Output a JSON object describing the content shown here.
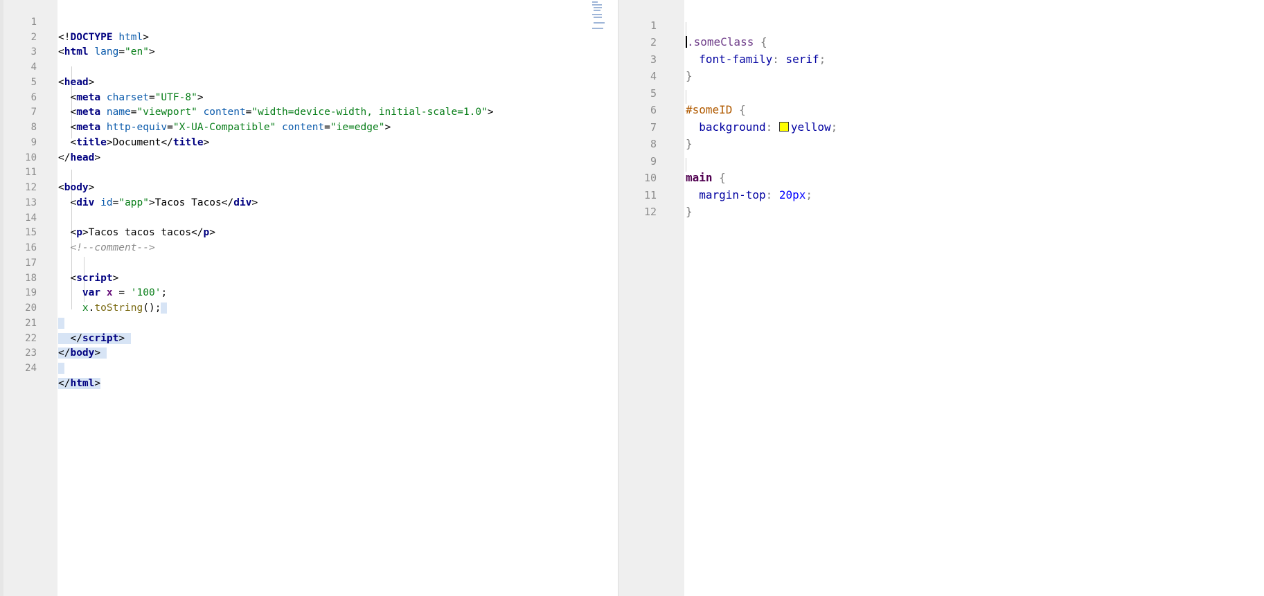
{
  "html_editor": {
    "line_numbers": [
      "1",
      "2",
      "3",
      "4",
      "5",
      "6",
      "7",
      "8",
      "9",
      "10",
      "11",
      "12",
      "13",
      "14",
      "15",
      "16",
      "17",
      "18",
      "19",
      "20",
      "21",
      "22",
      "23",
      "24"
    ],
    "l1": {
      "open": "<!",
      "doctype": "DOCTYPE",
      "sp": " ",
      "html": "html",
      "close": ">"
    },
    "l2": {
      "lt": "<",
      "tag": "html",
      "sp": " ",
      "attr": "lang",
      "eq": "=",
      "val": "\"en\"",
      "gt": ">"
    },
    "l4": {
      "lt": "<",
      "tag": "head",
      "gt": ">"
    },
    "l5": {
      "lt": "<",
      "tag": "meta",
      "sp": " ",
      "attr": "charset",
      "eq": "=",
      "val": "\"UTF-8\"",
      "gt": ">"
    },
    "l6": {
      "lt": "<",
      "tag": "meta",
      "sp": " ",
      "attr1": "name",
      "eq": "=",
      "val1": "\"viewport\"",
      "sp2": " ",
      "attr2": "content",
      "val2": "\"width=device-width, initial-scale=1.0\"",
      "gt": ">"
    },
    "l7": {
      "lt": "<",
      "tag": "meta",
      "sp": " ",
      "attr1": "http-equiv",
      "eq": "=",
      "val1": "\"X-UA-Compatible\"",
      "sp2": " ",
      "attr2": "content",
      "val2": "\"ie=edge\"",
      "gt": ">"
    },
    "l8": {
      "lt": "<",
      "tag": "title",
      "gt": ">",
      "text": "Document",
      "lt2": "</",
      "tag2": "title",
      "gt2": ">"
    },
    "l9": {
      "lt": "</",
      "tag": "head",
      "gt": ">"
    },
    "l11": {
      "lt": "<",
      "tag": "body",
      "gt": ">"
    },
    "l12": {
      "lt": "<",
      "tag": "div",
      "sp": " ",
      "attr": "id",
      "eq": "=",
      "val": "\"app\"",
      "gt": ">",
      "text": "Tacos Tacos",
      "lt2": "</",
      "tag2": "div",
      "gt2": ">"
    },
    "l14": {
      "lt": "<",
      "tag": "p",
      "gt": ">",
      "text": "Tacos tacos tacos",
      "lt2": "</",
      "tag2": "p",
      "gt2": ">"
    },
    "l15": {
      "comment": "<!--comment-->"
    },
    "l17": {
      "lt": "<",
      "tag": "script",
      "gt": ">"
    },
    "l18": {
      "kw": "var",
      "sp": " ",
      "var": "x",
      "op": " = ",
      "str": "'100'",
      "semi": ";"
    },
    "l19": {
      "obj": "x",
      "dot": ".",
      "method": "toString",
      "rest": "();"
    },
    "l21": {
      "lt": "</",
      "tag": "script",
      "gt": ">"
    },
    "l22": {
      "lt": "</",
      "tag": "body",
      "gt": ">"
    },
    "l24": {
      "lt": "</",
      "tag": "html",
      "gt": ">"
    }
  },
  "css_editor": {
    "line_numbers": [
      "1",
      "2",
      "3",
      "4",
      "5",
      "6",
      "7",
      "8",
      "9",
      "10",
      "11",
      "12"
    ],
    "l1": {
      "selector": ".someClass",
      "brace": " {"
    },
    "l2": {
      "prop": "font-family",
      "colon": ": ",
      "val": "serif",
      "semi": ";"
    },
    "l3": {
      "brace": "}"
    },
    "l5": {
      "selector": "#someID",
      "brace": " {"
    },
    "l6": {
      "prop": "background",
      "colon": ": ",
      "val": "yellow",
      "semi": ";",
      "swatch_color": "#ffff00"
    },
    "l7": {
      "brace": "}"
    },
    "l9": {
      "selector": "main",
      "brace": " {"
    },
    "l10": {
      "prop": "margin-top",
      "colon": ": ",
      "val": "20px",
      "semi": ";"
    },
    "l11": {
      "brace": "}"
    }
  }
}
